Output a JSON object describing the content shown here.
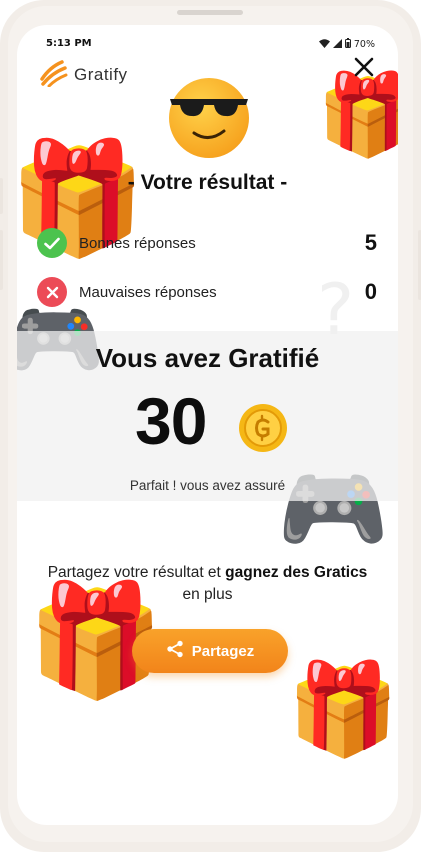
{
  "status": {
    "time": "5:13 PM",
    "battery": "70%"
  },
  "app": {
    "name": "Gratify"
  },
  "result": {
    "title": "- Votre résultat -",
    "correct_label": "Bonnes réponses",
    "correct_count": "5",
    "wrong_label": "Mauvaises réponses",
    "wrong_count": "0"
  },
  "gratified": {
    "title": "Vous avez Gratifié",
    "points": "30",
    "message": "Parfait ! vous avez assuré"
  },
  "share": {
    "text_prefix": "Partagez votre résultat et",
    "text_bold1": "gagnez des Gratics",
    "text_suffix": "en plus",
    "button_label": "Partagez"
  },
  "colors": {
    "accent": "#f59020",
    "success": "#4cc34e",
    "error": "#ec4b57",
    "coin": "#f5b715"
  }
}
